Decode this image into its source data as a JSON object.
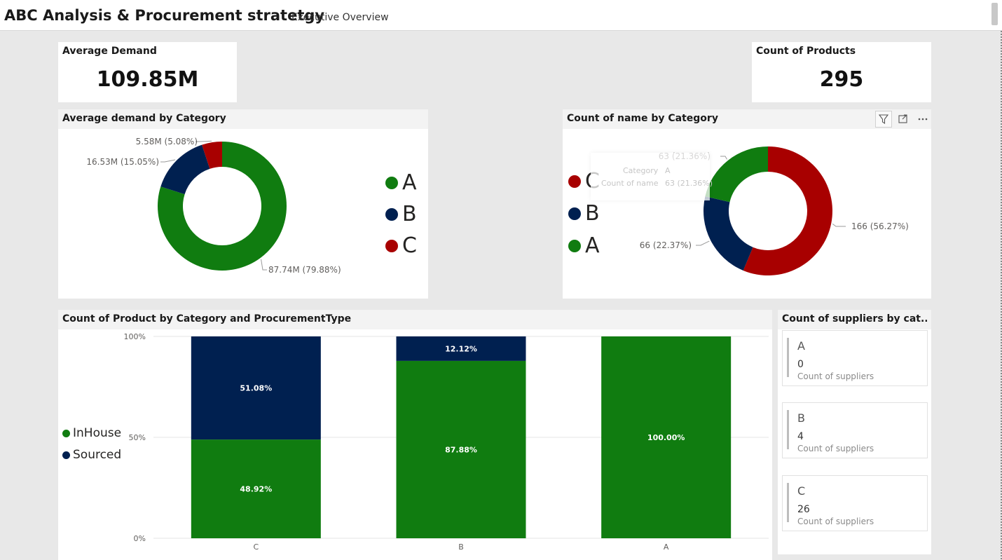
{
  "header": {
    "title": "ABC Analysis & Procurement stratetgy",
    "subtitle": "Executive Overview"
  },
  "kpis": {
    "average_demand": {
      "label": "Average Demand",
      "value": "109.85M"
    },
    "count_products": {
      "label": "Count of Products",
      "value": "295"
    }
  },
  "colors": {
    "A": "#107c10",
    "B": "#002050",
    "C": "#a80000"
  },
  "icons": [
    "filter-icon",
    "focus-mode-icon",
    "more-options-icon"
  ],
  "chart_data": [
    {
      "type": "pie",
      "title": "Average demand by Category",
      "legend": [
        "A",
        "B",
        "C"
      ],
      "slices": [
        {
          "category": "A",
          "value": 87.74,
          "label": "87.74M (79.88%)",
          "color": "#107c10"
        },
        {
          "category": "B",
          "value": 16.53,
          "label": "16.53M (15.05%)",
          "color": "#002050"
        },
        {
          "category": "C",
          "value": 5.58,
          "label": "5.58M (5.08%)",
          "color": "#a80000"
        }
      ]
    },
    {
      "type": "pie",
      "title": "Count of name by Category",
      "legend": [
        "C",
        "B",
        "A"
      ],
      "slices": [
        {
          "category": "C",
          "value": 166,
          "label": "166 (56.27%)",
          "color": "#a80000"
        },
        {
          "category": "B",
          "value": 66,
          "label": "66 (22.37%)",
          "color": "#002050"
        },
        {
          "category": "A",
          "value": 63,
          "label": "63 (21.36%)",
          "color": "#107c10"
        }
      ],
      "tooltip": {
        "rows": [
          {
            "key": "Category",
            "value": "A"
          },
          {
            "key": "Count of name",
            "value": "63 (21.36%)"
          }
        ]
      }
    },
    {
      "type": "bar",
      "stacked": "100%",
      "title": "Count of Product  by Category and ProcurementType",
      "categories": [
        "C",
        "B",
        "A"
      ],
      "series": [
        {
          "name": "InHouse",
          "color": "#107c10",
          "values": [
            48.92,
            87.88,
            100.0
          ],
          "labels": [
            "48.92%",
            "87.88%",
            "100.00%"
          ]
        },
        {
          "name": "Sourced",
          "color": "#002050",
          "values": [
            51.08,
            12.12,
            0
          ],
          "labels": [
            "51.08%",
            "12.12%",
            ""
          ]
        }
      ],
      "y_ticks": [
        "0%",
        "50%",
        "100%"
      ],
      "ylim": [
        0,
        100
      ]
    }
  ],
  "suppliers": {
    "title": "Count of suppliers by cat...",
    "cards": [
      {
        "category": "A",
        "value": "0",
        "label": "Count of suppliers"
      },
      {
        "category": "B",
        "value": "4",
        "label": "Count of suppliers"
      },
      {
        "category": "C",
        "value": "26",
        "label": "Count of suppliers"
      }
    ]
  }
}
